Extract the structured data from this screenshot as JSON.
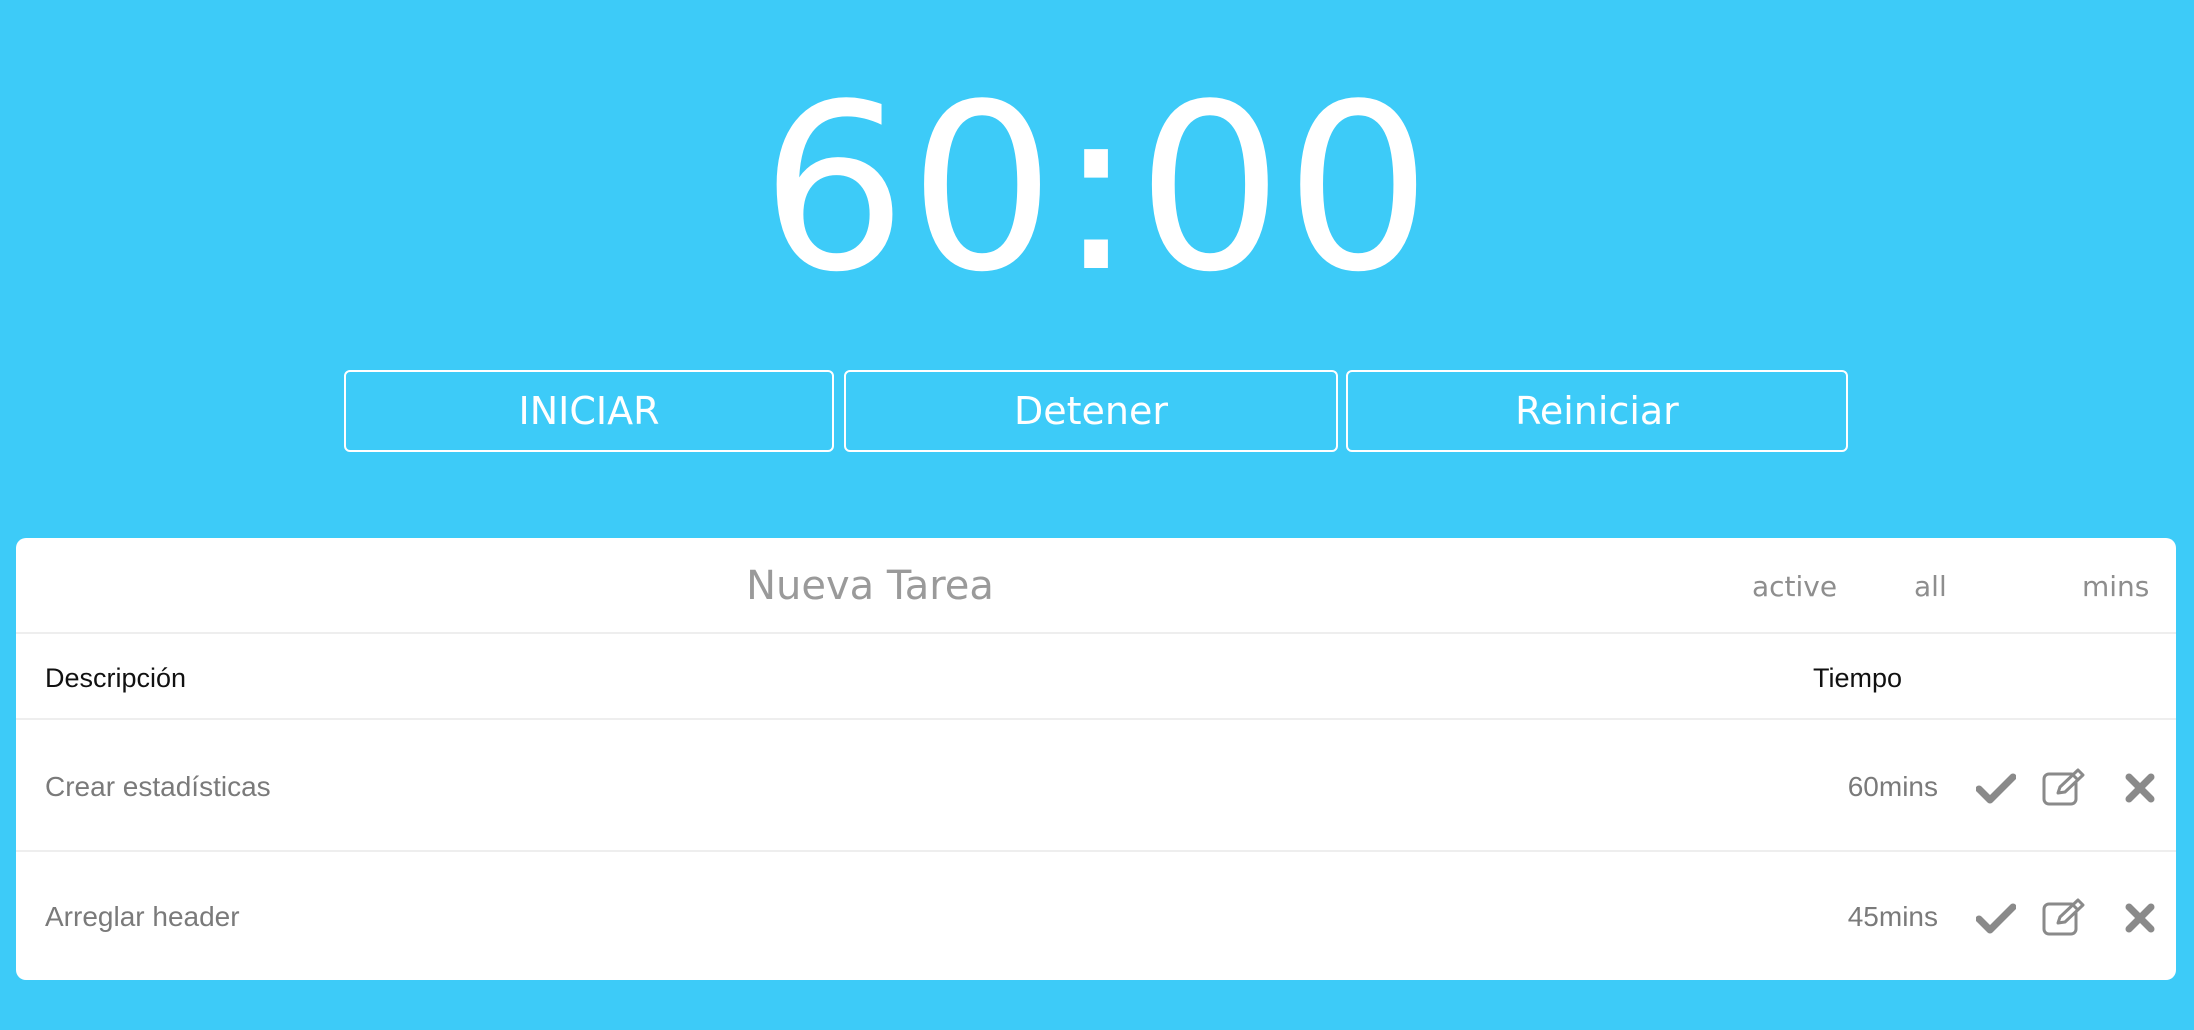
{
  "timer": {
    "display": "60:00"
  },
  "controls": {
    "start_label": "INICIAR",
    "stop_label": "Detener",
    "reset_label": "Reiniciar"
  },
  "tasks_panel": {
    "new_task_placeholder": "Nueva Tarea",
    "filters": {
      "active": "active",
      "all": "all",
      "mins": "mins"
    },
    "columns": {
      "description": "Descripción",
      "time": "Tiempo"
    },
    "rows": [
      {
        "description": "Crear estadísticas",
        "time": "60mins"
      },
      {
        "description": "Arreglar header",
        "time": "45mins"
      }
    ],
    "row_actions": [
      "check-icon",
      "edit-icon",
      "delete-icon"
    ]
  },
  "colors": {
    "background": "#3dcbf8",
    "panel": "#ffffff",
    "icon": "#8a8a8a",
    "muted_text": "#7a7a7a"
  }
}
